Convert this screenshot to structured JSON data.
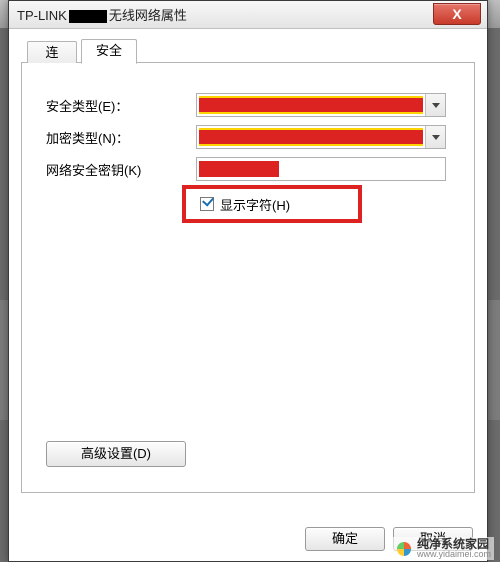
{
  "window": {
    "title_prefix": "TP-LINK",
    "title_suffix": "无线网络属性",
    "close_glyph": "X"
  },
  "tabs": {
    "connect": "连接",
    "security": "安全"
  },
  "form": {
    "security_type_label": "安全类型(E)：",
    "encryption_type_label": "加密类型(N)：",
    "security_key_label": "网络安全密钥(K)",
    "show_chars_label": "显示字符(H)",
    "show_chars_checked": true
  },
  "buttons": {
    "advanced": "高级设置(D)",
    "ok": "确定",
    "cancel": "取消"
  },
  "watermark": {
    "brand": "纯净系统家园",
    "url": "www.yidaimei.com"
  }
}
